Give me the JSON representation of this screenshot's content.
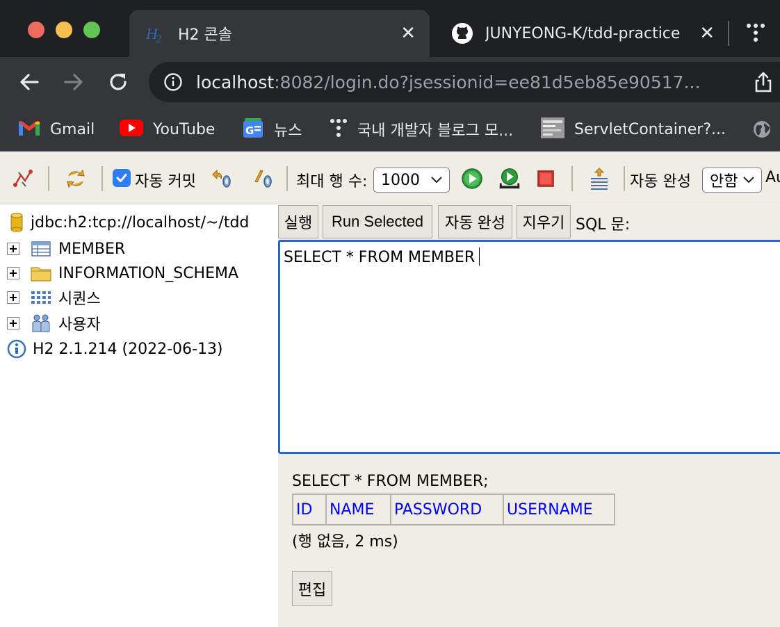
{
  "browser": {
    "tabs": [
      {
        "title": "H2 콘솔",
        "favicon": "h2-icon",
        "active": true
      },
      {
        "title": "JUNYEONG-K/tdd-practice",
        "favicon": "github-icon",
        "active": false
      }
    ],
    "address": {
      "host": "localhost",
      "rest": ":8082/login.do?jsessionid=ee81d5eb85e90517..."
    },
    "bookmarks": [
      {
        "label": "Gmail",
        "icon": "gmail-icon"
      },
      {
        "label": "YouTube",
        "icon": "youtube-icon"
      },
      {
        "label": "뉴스",
        "icon": "google-news-icon"
      },
      {
        "label": "국내 개발자 블로그 모...",
        "icon": "dots-icon"
      },
      {
        "label": "ServletContainer?...",
        "icon": "thumbnail-icon"
      }
    ]
  },
  "toolbar": {
    "autocommit_label": "자동 커밋",
    "autocommit_checked": true,
    "max_rows_label": "최대 행 수:",
    "max_rows_value": "1000",
    "autocomplete_label": "자동 완성",
    "autocomplete_value": "안함",
    "trailing_text": "Au"
  },
  "tree": {
    "connection": "jdbc:h2:tcp://localhost/~/tdd",
    "items": [
      {
        "label": "MEMBER",
        "icon": "table-icon"
      },
      {
        "label": "INFORMATION_SCHEMA",
        "icon": "folder-icon"
      },
      {
        "label": "시퀀스",
        "icon": "sequence-icon"
      },
      {
        "label": "사용자",
        "icon": "users-icon"
      }
    ],
    "version": "H2 2.1.214 (2022-06-13)"
  },
  "sql": {
    "buttons": {
      "run": "실행",
      "run_selected": "Run Selected",
      "autocomplete": "자동 완성",
      "clear": "지우기"
    },
    "label": "SQL 문:",
    "query": "SELECT * FROM MEMBER"
  },
  "result": {
    "statement": "SELECT * FROM MEMBER;",
    "columns": [
      "ID",
      "NAME",
      "PASSWORD",
      "USERNAME"
    ],
    "info": "(행 없음, 2 ms)",
    "edit_label": "편집"
  },
  "colors": {
    "chrome_dark": "#1f2023",
    "chrome_tab": "#35363a",
    "console_bg": "#efede4",
    "link_blue": "#0000ee",
    "focus_blue": "#2c63c9"
  }
}
